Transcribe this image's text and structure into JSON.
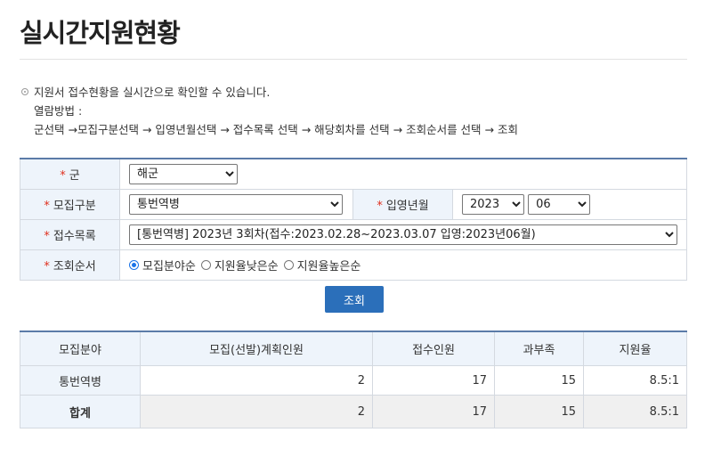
{
  "page": {
    "title": "실시간지원현황"
  },
  "info": {
    "line1": "지원서 접수현황을 실시간으로 확인할 수 있습니다.",
    "line2": "열람방법 :",
    "line3": "군선택 →모집구분선택 → 입영년월선택 → 접수목록 선택 → 해당회차를 선택 → 조회순서를 선택 → 조회"
  },
  "form": {
    "required_mark": "*",
    "branch": {
      "label": "군",
      "value": "해군"
    },
    "recruit_type": {
      "label": "모집구분",
      "value": "통번역병"
    },
    "enlist_date": {
      "label": "입영년월",
      "year": "2023",
      "month": "06"
    },
    "application_list": {
      "label": "접수목록",
      "value": "[통번역병] 2023년 3회차(접수:2023.02.28~2023.03.07 입영:2023년06월)"
    },
    "sort_order": {
      "label": "조회순서",
      "options": [
        "모집분야순",
        "지원율낮은순",
        "지원율높은순"
      ],
      "selected_index": 0
    }
  },
  "search_button": "조회",
  "results": {
    "headers": [
      "모집분야",
      "모집(선발)계획인원",
      "접수인원",
      "과부족",
      "지원율"
    ],
    "rows": [
      {
        "field": "통번역병",
        "planned": "2",
        "applied": "17",
        "surplus": "15",
        "ratio": "8.5:1"
      }
    ],
    "total": {
      "label": "합계",
      "planned": "2",
      "applied": "17",
      "surplus": "15",
      "ratio": "8.5:1"
    }
  },
  "colors": {
    "accent": "#2b6fba",
    "header_bg": "#eef4fb",
    "required": "#e0301e"
  }
}
